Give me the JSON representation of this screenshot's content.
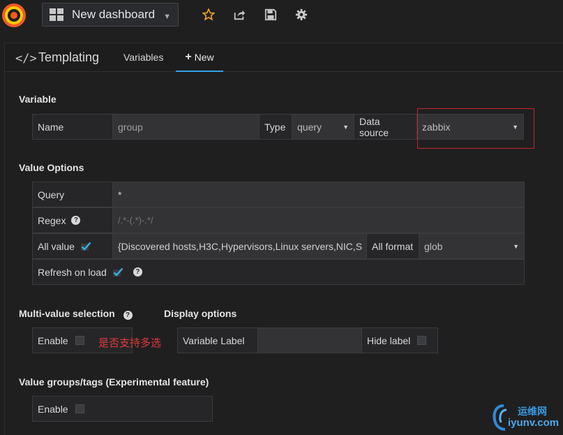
{
  "topnav": {
    "dashboard_title": "New dashboard",
    "icons": [
      "grafana-logo-icon",
      "dashboard-grid-icon",
      "star-icon",
      "share-icon",
      "save-icon",
      "gear-icon"
    ]
  },
  "panel": {
    "title": "Templating",
    "tabs": [
      {
        "label": "Variables"
      },
      {
        "label": "New"
      }
    ]
  },
  "variable": {
    "section_title": "Variable",
    "name_label": "Name",
    "name_value": "group",
    "type_label": "Type",
    "type_value": "query",
    "datasource_label": "Data source",
    "datasource_value": "zabbix"
  },
  "value_options": {
    "section_title": "Value Options",
    "query_label": "Query",
    "query_value": "*",
    "regex_label": "Regex",
    "regex_placeholder": "/.*-(.*)-.*/",
    "all_value_label": "All value",
    "all_value_checked": true,
    "all_value_value": "{Discovered hosts,H3C,Hypervisors,Linux servers,NIC,S",
    "all_format_label": "All format",
    "all_format_value": "glob",
    "refresh_label": "Refresh on load",
    "refresh_checked": true
  },
  "multi_value": {
    "section_title": "Multi-value selection",
    "enable_label": "Enable",
    "annotation": "是否支持多选"
  },
  "display_options": {
    "section_title": "Display options",
    "variable_label": "Variable Label",
    "hide_label": "Hide label"
  },
  "value_groups": {
    "section_title": "Value groups/tags (Experimental feature)",
    "enable_label": "Enable"
  },
  "watermark": {
    "cn_text": "运维网",
    "url_text": "iyunv.com"
  },
  "colors": {
    "accent": "#33a2e5",
    "annotation_red": "#c8262b",
    "check_blue": "#33b5e5"
  }
}
